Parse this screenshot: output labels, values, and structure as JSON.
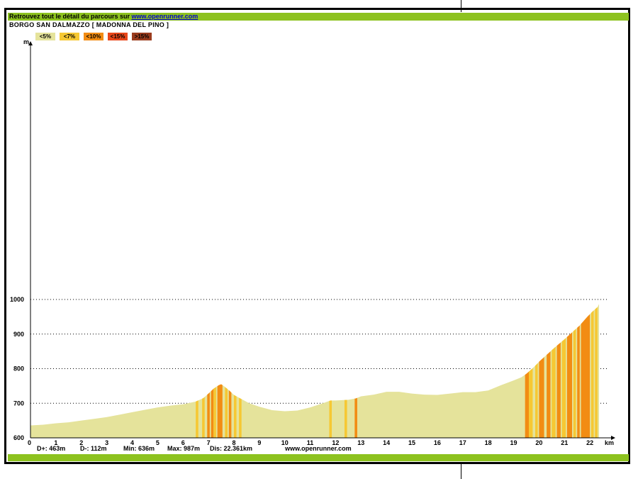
{
  "header": {
    "prefix": "Retrouvez tout le détail du parcours sur ",
    "site_link": "www.openrunner.com"
  },
  "route_title": "BORGO SAN DALMAZZO [ MADONNA DEL PINO ]",
  "legend": [
    {
      "label": "<5%",
      "color": "#e5e39b"
    },
    {
      "label": "<7%",
      "color": "#f6c833"
    },
    {
      "label": "<10%",
      "color": "#f28c13"
    },
    {
      "label": "<15%",
      "color": "#e8461a"
    },
    {
      "label": ">15%",
      "color": "#9b3c1e"
    }
  ],
  "stats": {
    "d_plus": "D+: 463m",
    "d_minus": "D-: 112m",
    "min": "Min: 636m",
    "max": "Max: 987m",
    "dist": "Dis: 22.361km",
    "site": "www.openrunner.com"
  },
  "chart_data": {
    "type": "area",
    "title": "BORGO SAN DALMAZZO [ MADONNA DEL PINO ]",
    "xlabel": "km",
    "ylabel": "m",
    "xlim": [
      0,
      23
    ],
    "ylim": [
      600,
      1000
    ],
    "x_ticks": [
      "0",
      "1",
      "2",
      "3",
      "4",
      "5",
      "6",
      "7",
      "8",
      "9",
      "10",
      "11",
      "12",
      "13",
      "14",
      "15",
      "16",
      "17",
      "18",
      "19",
      "20",
      "21",
      "22"
    ],
    "y_ticks": [
      "600",
      "700",
      "800",
      "900",
      "1000"
    ],
    "grid": "horizontal dotted",
    "elevation_profile": {
      "x": [
        0,
        0.5,
        1,
        1.5,
        2,
        2.5,
        3,
        3.5,
        4,
        4.5,
        5,
        5.5,
        6,
        6.5,
        6.8,
        7,
        7.2,
        7.4,
        7.5,
        7.6,
        7.8,
        8,
        8.3,
        8.6,
        9,
        9.5,
        10,
        10.5,
        11,
        11.5,
        11.8,
        12,
        12.5,
        12.8,
        13,
        13.5,
        14,
        14.5,
        15,
        15.5,
        16,
        16.5,
        17,
        17.5,
        18,
        18.5,
        19,
        19.3,
        19.5,
        19.7,
        19.9,
        20,
        20.3,
        20.6,
        21,
        21.3,
        21.6,
        21.9,
        22.1,
        22.3,
        22.36
      ],
      "y": [
        636,
        638,
        642,
        645,
        650,
        655,
        660,
        667,
        674,
        681,
        688,
        693,
        697,
        705,
        715,
        728,
        742,
        752,
        755,
        750,
        738,
        724,
        712,
        700,
        690,
        680,
        677,
        679,
        688,
        700,
        708,
        708,
        710,
        714,
        720,
        725,
        733,
        733,
        728,
        725,
        724,
        728,
        732,
        732,
        737,
        752,
        766,
        775,
        785,
        798,
        812,
        820,
        840,
        860,
        885,
        905,
        925,
        950,
        965,
        978,
        987
      ]
    },
    "gradient_segments": [
      {
        "from": 6.5,
        "to": 6.6,
        "class": "<7%"
      },
      {
        "from": 6.75,
        "to": 6.85,
        "class": "<7%"
      },
      {
        "from": 6.95,
        "to": 7.05,
        "class": "<10%"
      },
      {
        "from": 7.1,
        "to": 7.2,
        "class": "<10%"
      },
      {
        "from": 7.2,
        "to": 7.3,
        "class": "<7%"
      },
      {
        "from": 7.35,
        "to": 7.55,
        "class": "<10%"
      },
      {
        "from": 7.65,
        "to": 7.75,
        "class": "<7%"
      },
      {
        "from": 7.8,
        "to": 7.9,
        "class": "<10%"
      },
      {
        "from": 8.0,
        "to": 8.1,
        "class": "<7%"
      },
      {
        "from": 8.2,
        "to": 8.3,
        "class": "<7%"
      },
      {
        "from": 11.75,
        "to": 11.85,
        "class": "<7%"
      },
      {
        "from": 12.35,
        "to": 12.45,
        "class": "<7%"
      },
      {
        "from": 12.75,
        "to": 12.85,
        "class": "<10%"
      },
      {
        "from": 19.45,
        "to": 19.6,
        "class": "<10%"
      },
      {
        "from": 19.6,
        "to": 19.75,
        "class": "<7%"
      },
      {
        "from": 19.85,
        "to": 19.95,
        "class": "<7%"
      },
      {
        "from": 20.0,
        "to": 20.2,
        "class": "<10%"
      },
      {
        "from": 20.3,
        "to": 20.45,
        "class": "<10%"
      },
      {
        "from": 20.5,
        "to": 20.65,
        "class": "<7%"
      },
      {
        "from": 20.7,
        "to": 20.85,
        "class": "<10%"
      },
      {
        "from": 20.9,
        "to": 21.05,
        "class": "<7%"
      },
      {
        "from": 21.1,
        "to": 21.3,
        "class": "<10%"
      },
      {
        "from": 21.35,
        "to": 21.45,
        "class": "<7%"
      },
      {
        "from": 21.5,
        "to": 21.6,
        "class": "<10%"
      },
      {
        "from": 21.65,
        "to": 22.0,
        "class": "<10%"
      },
      {
        "from": 22.05,
        "to": 22.15,
        "class": "<7%"
      },
      {
        "from": 22.2,
        "to": 22.3,
        "class": "<7%"
      }
    ]
  }
}
